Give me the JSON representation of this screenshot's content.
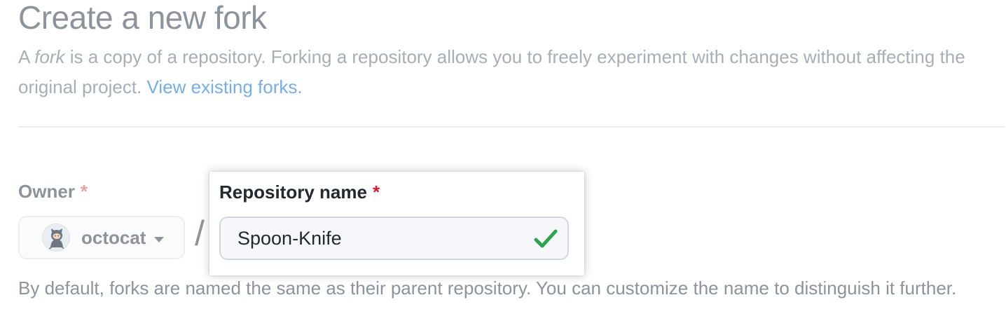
{
  "header": {
    "title": "Create a new fork",
    "desc_prefix": "A ",
    "desc_fork_word": "fork",
    "desc_rest": " is a copy of a repository. Forking a repository allows you to freely experiment with changes without affecting the original project. ",
    "view_forks_link": "View existing forks."
  },
  "owner": {
    "label": "Owner",
    "required_marker": "*",
    "selected": "octocat",
    "avatar_icon": "octocat-avatar-icon",
    "dropdown_icon": "caret-down-icon"
  },
  "separator": "/",
  "repository": {
    "label": "Repository name",
    "required_marker": "*",
    "value": "Spoon-Knife",
    "valid_icon": "check-icon",
    "valid_color": "#2da44e"
  },
  "help_text": "By default, forks are named the same as their parent repository. You can customize the name to distinguish it further.",
  "colors": {
    "link": "#76aee8",
    "required": "#cf222e",
    "muted_text": "#8d939a"
  }
}
